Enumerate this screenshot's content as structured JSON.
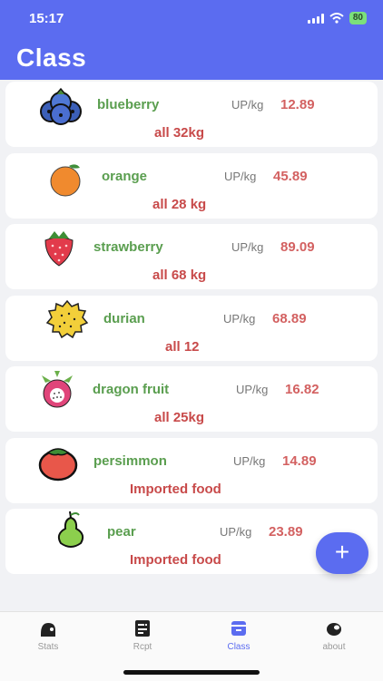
{
  "status_bar": {
    "time": "15:17",
    "battery": "80"
  },
  "header": {
    "title": "Class"
  },
  "items": [
    {
      "name": "blueberry",
      "unit": "UP/kg",
      "price": "12.89",
      "total": "all 32kg",
      "icon": "blueberry-icon"
    },
    {
      "name": "orange",
      "unit": "UP/kg",
      "price": "45.89",
      "total": "all 28 kg",
      "icon": "orange-icon"
    },
    {
      "name": "strawberry",
      "unit": "UP/kg",
      "price": "89.09",
      "total": "all 68 kg",
      "icon": "strawberry-icon"
    },
    {
      "name": "durian",
      "unit": "UP/kg",
      "price": "68.89",
      "total": "all 12",
      "icon": "durian-icon"
    },
    {
      "name": "dragon fruit",
      "unit": "UP/kg",
      "price": "16.82",
      "total": "all 25kg",
      "icon": "dragon-fruit-icon"
    },
    {
      "name": "persimmon",
      "unit": "UP/kg",
      "price": "14.89",
      "total": "Imported food",
      "icon": "persimmon-icon"
    },
    {
      "name": "pear",
      "unit": "UP/kg",
      "price": "23.89",
      "total": "Imported food",
      "icon": "pear-icon"
    }
  ],
  "fab": {
    "label": "+"
  },
  "tabs": [
    {
      "label": "Stats",
      "icon": "stats-icon"
    },
    {
      "label": "Rcpt",
      "icon": "receipt-icon"
    },
    {
      "label": "Class",
      "icon": "class-icon",
      "active": true
    },
    {
      "label": "about",
      "icon": "about-icon"
    }
  ],
  "colors": {
    "accent": "#5b6cf0",
    "name_green": "#5a9e4f",
    "price_red": "#d36161"
  }
}
